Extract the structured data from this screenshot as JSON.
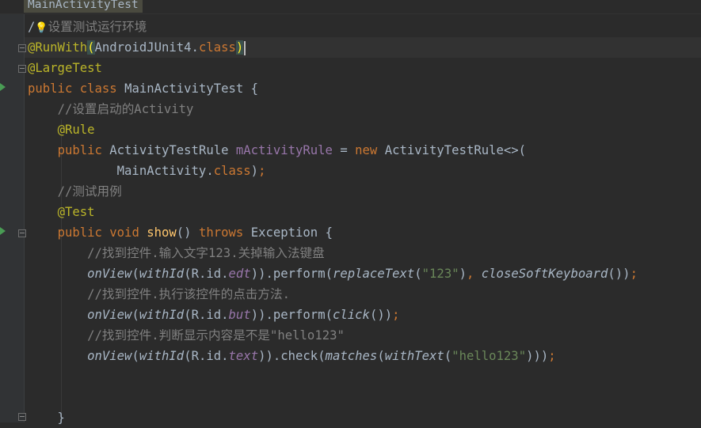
{
  "editor": {
    "tab_title": "MainActivityTest",
    "lines": [
      [
        {
          "t": "/"
        },
        {
          "t": "💡",
          "c": "bulb"
        },
        {
          "t": "设置测试运行环境",
          "c": "cm"
        }
      ],
      [
        {
          "t": "@RunWith",
          "c": "ann"
        },
        {
          "t": "(",
          "c": "brace-hl"
        },
        {
          "t": "AndroidJUnit4."
        },
        {
          "t": "class",
          "c": "kw"
        },
        {
          "t": ")",
          "c": "brace-hl"
        },
        {
          "t": "",
          "c": "caret"
        }
      ],
      [
        {
          "t": "@LargeTest",
          "c": "ann"
        }
      ],
      [
        {
          "t": "public class ",
          "c": "kw"
        },
        {
          "t": "MainActivityTest {"
        }
      ],
      [
        {
          "t": "    "
        },
        {
          "t": "//设置启动的Activity",
          "c": "cm"
        }
      ],
      [
        {
          "t": "    "
        },
        {
          "t": "@Rule",
          "c": "ann"
        }
      ],
      [
        {
          "t": "    "
        },
        {
          "t": "public ",
          "c": "kw"
        },
        {
          "t": "ActivityTestRule "
        },
        {
          "t": "mActivityRule",
          "c": "fld"
        },
        {
          "t": " = "
        },
        {
          "t": "new ",
          "c": "kw"
        },
        {
          "t": "ActivityTestRule<>("
        }
      ],
      [
        {
          "t": "            MainActivity."
        },
        {
          "t": "class",
          "c": "kw"
        },
        {
          "t": ")"
        },
        {
          "t": ";",
          "c": "kw"
        }
      ],
      [
        {
          "t": "    "
        },
        {
          "t": "//测试用例",
          "c": "cm"
        }
      ],
      [
        {
          "t": "    "
        },
        {
          "t": "@Test",
          "c": "ann"
        }
      ],
      [
        {
          "t": "    "
        },
        {
          "t": "public void ",
          "c": "kw"
        },
        {
          "t": "show",
          "c": "fn"
        },
        {
          "t": "() "
        },
        {
          "t": "throws ",
          "c": "kw"
        },
        {
          "t": "Exception {"
        }
      ],
      [
        {
          "t": "        "
        },
        {
          "t": "//找到控件.输入文字123.关掉输入法键盘",
          "c": "cm"
        }
      ],
      [
        {
          "t": "        "
        },
        {
          "t": "onView",
          "c": "it"
        },
        {
          "t": "("
        },
        {
          "t": "withId",
          "c": "it"
        },
        {
          "t": "(R.id."
        },
        {
          "t": "edt",
          "c": "fldit"
        },
        {
          "t": ")).perform("
        },
        {
          "t": "replaceText",
          "c": "it"
        },
        {
          "t": "("
        },
        {
          "t": "\"123\"",
          "c": "str"
        },
        {
          "t": ")"
        },
        {
          "t": ", ",
          "c": "kw"
        },
        {
          "t": "closeSoftKeyboard",
          "c": "it"
        },
        {
          "t": "())"
        },
        {
          "t": ";",
          "c": "kw"
        }
      ],
      [
        {
          "t": "        "
        },
        {
          "t": "//找到控件.执行该控件的点击方法.",
          "c": "cm"
        }
      ],
      [
        {
          "t": "        "
        },
        {
          "t": "onView",
          "c": "it"
        },
        {
          "t": "("
        },
        {
          "t": "withId",
          "c": "it"
        },
        {
          "t": "(R.id."
        },
        {
          "t": "but",
          "c": "fldit"
        },
        {
          "t": ")).perform("
        },
        {
          "t": "click",
          "c": "it"
        },
        {
          "t": "())"
        },
        {
          "t": ";",
          "c": "kw"
        }
      ],
      [
        {
          "t": "        "
        },
        {
          "t": "//找到控件.判断显示内容是不是\"hello123\"",
          "c": "cm"
        }
      ],
      [
        {
          "t": "        "
        },
        {
          "t": "onView",
          "c": "it"
        },
        {
          "t": "("
        },
        {
          "t": "withId",
          "c": "it"
        },
        {
          "t": "(R.id."
        },
        {
          "t": "text",
          "c": "fldit"
        },
        {
          "t": ")).check("
        },
        {
          "t": "matches",
          "c": "it"
        },
        {
          "t": "("
        },
        {
          "t": "withText",
          "c": "it"
        },
        {
          "t": "("
        },
        {
          "t": "\"hello123\"",
          "c": "str"
        },
        {
          "t": ")))"
        },
        {
          "t": ";",
          "c": "kw"
        }
      ],
      [
        {
          "t": ""
        }
      ],
      [
        {
          "t": ""
        }
      ],
      [
        {
          "t": "    }"
        }
      ]
    ]
  }
}
